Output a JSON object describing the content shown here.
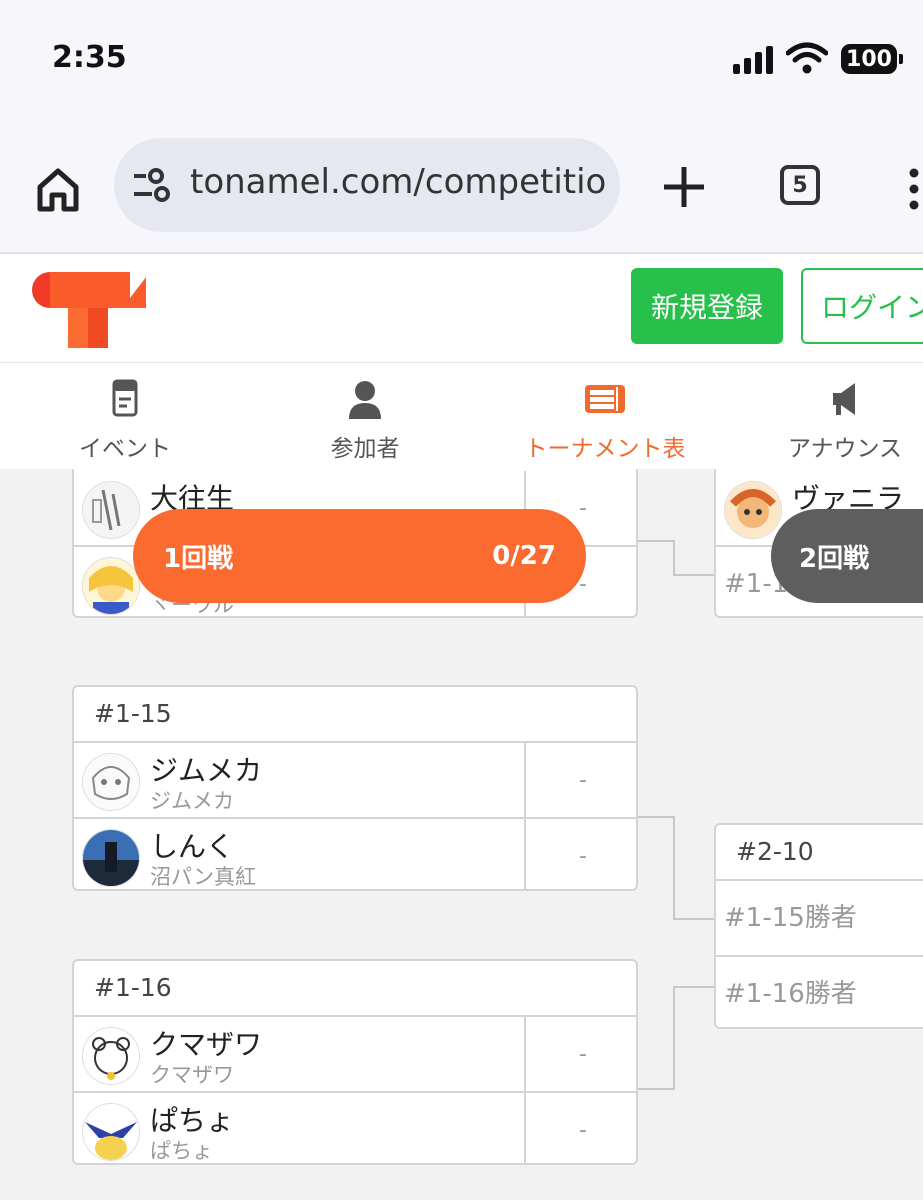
{
  "status_bar": {
    "time": "2:35",
    "battery": "100"
  },
  "browser": {
    "url": "tonamel.com/competitio",
    "tab_count": "5"
  },
  "header": {
    "signup_label": "新規登録",
    "login_label": "ログイン"
  },
  "nav_tabs": [
    {
      "label": "イベント",
      "icon": "document-icon",
      "active": false
    },
    {
      "label": "参加者",
      "icon": "person-icon",
      "active": false
    },
    {
      "label": "トーナメント表",
      "icon": "bracket-list-icon",
      "active": true
    },
    {
      "label": "アナウンス",
      "icon": "megaphone-icon",
      "active": false
    }
  ],
  "colors": {
    "accent": "#fb6a2f",
    "green": "#27c04a",
    "round2": "#5e5e5e"
  },
  "rounds": {
    "r1": {
      "label": "1回戦",
      "progress": "0/27"
    },
    "r2": {
      "label": "2回戦"
    }
  },
  "matches": {
    "m1_14": {
      "p1": {
        "name": "大往生"
      },
      "p1_score": "-",
      "p2_score": "-",
      "p2_sub_partial": "ヾーワル"
    },
    "m1_15": {
      "id": "#1-15",
      "p1": {
        "name": "ジムメカ",
        "sub": "ジムメカ",
        "score": "-"
      },
      "p2": {
        "name": "しんく",
        "sub": "沼パン真紅",
        "score": "-"
      }
    },
    "m1_16": {
      "id": "#1-16",
      "p1": {
        "name": "クマザワ",
        "sub": "クマザワ",
        "score": "-"
      },
      "p2": {
        "name": "ぱちょ",
        "sub": "ぱちょ",
        "score": "-"
      }
    },
    "m2_top": {
      "p1": {
        "name": "ヴァニラ"
      },
      "p2_partial": "#1-1"
    },
    "m2_10": {
      "id": "#2-10",
      "p1": "#1-15勝者",
      "p2": "#1-16勝者"
    }
  }
}
